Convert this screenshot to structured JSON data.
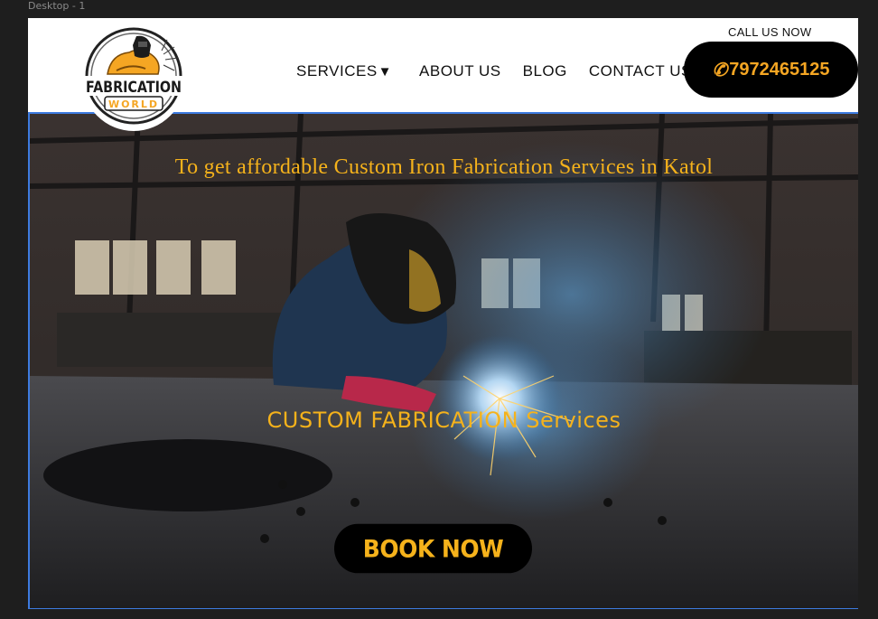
{
  "frame": {
    "label": "Desktop - 1"
  },
  "logo": {
    "line1": "FABRICATION",
    "line2": "WORLD"
  },
  "nav": {
    "items": [
      {
        "label": "SERVICES",
        "caret": "▼"
      },
      {
        "label": "ABOUT US"
      },
      {
        "label": "BLOG"
      },
      {
        "label": "CONTACT US"
      }
    ]
  },
  "call": {
    "label": "CALL US NOW",
    "icon": "✆",
    "phone": "7972465125"
  },
  "hero": {
    "tagline": "To get affordable Custom Iron Fabrication Services in Katol",
    "title": "CUSTOM FABRICATION Services",
    "cta": "BOOK NOW"
  },
  "colors": {
    "accent": "#f5b21b",
    "selection": "#3d7be0",
    "button_bg": "#000000"
  }
}
